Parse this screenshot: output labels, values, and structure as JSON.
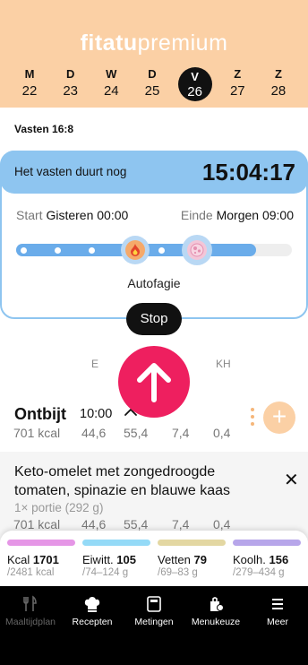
{
  "app": {
    "logo_brand": "fitatu",
    "logo_tier": "premium"
  },
  "week": [
    {
      "letter": "M",
      "num": "22"
    },
    {
      "letter": "D",
      "num": "23"
    },
    {
      "letter": "W",
      "num": "24"
    },
    {
      "letter": "D",
      "num": "25"
    },
    {
      "letter": "V",
      "num": "26"
    },
    {
      "letter": "Z",
      "num": "27"
    },
    {
      "letter": "Z",
      "num": "28"
    }
  ],
  "fasting": {
    "plan": "Vasten 16:8",
    "status_label": "Het vasten duurt nog",
    "remaining": "15:04:17",
    "start_label": "Start",
    "start_value": "Gisteren 00:00",
    "end_label": "Einde",
    "end_value": "Morgen 09:00",
    "progress": 0.87,
    "stage": "Autofagie",
    "stop_label": "Stop",
    "color": "#8ec5f0"
  },
  "columns": {
    "e": "E",
    "kh": "KH"
  },
  "meal": {
    "name": "Ontbijt",
    "time": "10:00",
    "kcal": "701 kcal",
    "e": "44,6",
    "v": "55,4",
    "vz": "7,4",
    "kh": "0,4"
  },
  "product": {
    "name": "Keto-omelet met zongedroogde tomaten, spinazie en blauwe kaas",
    "portion": "1× portie (292 g)",
    "kcal": "701 kcal",
    "e": "44,6",
    "v": "55,4",
    "vz": "7,4",
    "kh": "0,4"
  },
  "summary": [
    {
      "label": "Kcal",
      "value": "1701",
      "target": "/2481 kcal",
      "color": "#e596e6"
    },
    {
      "label": "Eiwitt.",
      "value": "105",
      "target": "/74–124 g",
      "color": "#94daf7"
    },
    {
      "label": "Vetten",
      "value": "79",
      "target": "/69–83 g",
      "color": "#e3d7a2"
    },
    {
      "label": "Koolh.",
      "value": "156",
      "target": "/279–434 g",
      "color": "#b7a6ea"
    }
  ],
  "nav": [
    {
      "label": "Maaltijdplan",
      "icon": "fork-knife-icon"
    },
    {
      "label": "Recepten",
      "icon": "chef-hat-icon"
    },
    {
      "label": "Metingen",
      "icon": "scale-icon"
    },
    {
      "label": "Menukeuze",
      "icon": "bag-icon"
    },
    {
      "label": "Meer",
      "icon": "menu-icon"
    }
  ],
  "accent": "#ee1f5f"
}
